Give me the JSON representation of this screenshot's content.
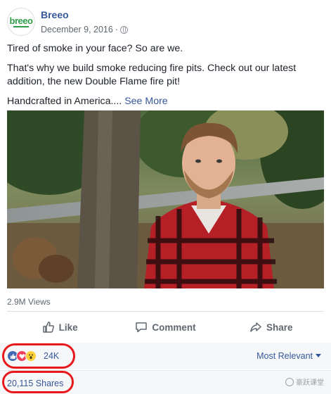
{
  "post": {
    "page_name": "Breeo",
    "date": "December 9, 2016",
    "privacy_icon": "globe-icon",
    "avatar_logo_text": "breeo",
    "text": {
      "line1": "Tired of smoke in your face? So are we.",
      "line2": "That's why we build smoke reducing fire pits. Check out our latest addition, the new Double Flame fire pit!",
      "line3": "Handcrafted in America....",
      "see_more": "See More"
    }
  },
  "video": {
    "views": "2.9M Views"
  },
  "actions": {
    "like": "Like",
    "comment": "Comment",
    "share": "Share"
  },
  "reactions": {
    "types": [
      "like",
      "love",
      "wow"
    ],
    "count": "24K",
    "sort_label": "Most Relevant"
  },
  "shares": {
    "label": "20,115 Shares"
  },
  "watermark": {
    "text": "豪跃课堂"
  },
  "colors": {
    "link": "#365899",
    "highlight": "#e8191d",
    "brand_green": "#2e9e4a"
  }
}
